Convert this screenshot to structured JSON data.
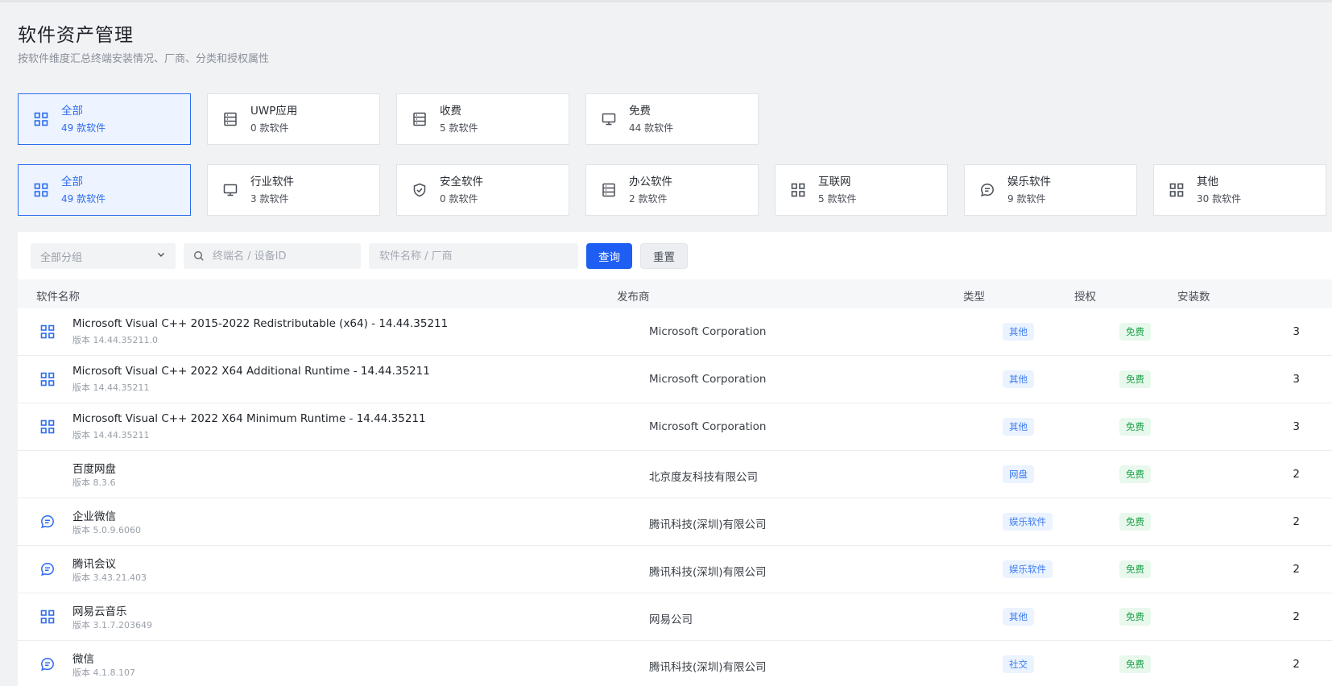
{
  "page": {
    "title": "软件资产管理",
    "subtitle": "按软件维度汇总终端安装情况、厂商、分类和授权属性"
  },
  "license_cards": [
    {
      "label": "全部",
      "count": "49 款软件",
      "icon": "grid-icon",
      "active": true
    },
    {
      "label": "UWP应用",
      "count": "0 款软件",
      "icon": "list-icon",
      "active": false
    },
    {
      "label": "收费",
      "count": "5 款软件",
      "icon": "list-icon",
      "active": false
    },
    {
      "label": "免费",
      "count": "44 款软件",
      "icon": "monitor-icon",
      "active": false
    }
  ],
  "category_cards": [
    {
      "label": "全部",
      "count": "49 款软件",
      "icon": "grid-icon",
      "active": true
    },
    {
      "label": "行业软件",
      "count": "3 款软件",
      "icon": "monitor-icon",
      "active": false
    },
    {
      "label": "安全软件",
      "count": "0 款软件",
      "icon": "shield-icon",
      "active": false
    },
    {
      "label": "办公软件",
      "count": "2 款软件",
      "icon": "list-icon",
      "active": false
    },
    {
      "label": "互联网",
      "count": "5 款软件",
      "icon": "grid-icon",
      "active": false
    },
    {
      "label": "娱乐软件",
      "count": "9 款软件",
      "icon": "chat-icon",
      "active": false
    },
    {
      "label": "其他",
      "count": "30 款软件",
      "icon": "grid-icon",
      "active": false
    }
  ],
  "filters": {
    "group_select": "全部分组",
    "terminal_placeholder": "终端名 / 设备ID",
    "software_placeholder": "软件名称 / 厂商",
    "query_label": "查询",
    "reset_label": "重置"
  },
  "table": {
    "headers": {
      "name": "软件名称",
      "publisher": "发布商",
      "type": "类型",
      "license": "授权",
      "installs": "安装数"
    },
    "rows": [
      {
        "name": "Microsoft Visual C++ 2015-2022 Redistributable (x64) - 14.44.35211",
        "version": "版本 14.44.35211.0",
        "publisher": "Microsoft Corporation",
        "type": "其他",
        "license": "免费",
        "installs": "3",
        "icon": "grid-icon"
      },
      {
        "name": "Microsoft Visual C++ 2022 X64 Additional Runtime - 14.44.35211",
        "version": "版本 14.44.35211",
        "publisher": "Microsoft Corporation",
        "type": "其他",
        "license": "免费",
        "installs": "3",
        "icon": "grid-icon"
      },
      {
        "name": "Microsoft Visual C++ 2022 X64 Minimum Runtime - 14.44.35211",
        "version": "版本 14.44.35211",
        "publisher": "Microsoft Corporation",
        "type": "其他",
        "license": "免费",
        "installs": "3",
        "icon": "grid-icon"
      },
      {
        "name": "百度网盘",
        "version": "版本 8.3.6",
        "publisher": "北京度友科技有限公司",
        "type": "网盘",
        "license": "免费",
        "installs": "2",
        "icon": ""
      },
      {
        "name": "企业微信",
        "version": "版本 5.0.9.6060",
        "publisher": "腾讯科技(深圳)有限公司",
        "type": "娱乐软件",
        "license": "免费",
        "installs": "2",
        "icon": "chat-icon"
      },
      {
        "name": "腾讯会议",
        "version": "版本 3.43.21.403",
        "publisher": "腾讯科技(深圳)有限公司",
        "type": "娱乐软件",
        "license": "免费",
        "installs": "2",
        "icon": "chat-icon"
      },
      {
        "name": "网易云音乐",
        "version": "版本 3.1.7.203649",
        "publisher": "网易公司",
        "type": "其他",
        "license": "免费",
        "installs": "2",
        "icon": "grid-icon"
      },
      {
        "name": "微信",
        "version": "版本 4.1.8.107",
        "publisher": "腾讯科技(深圳)有限公司",
        "type": "社交",
        "license": "免费",
        "installs": "2",
        "icon": "chat-icon"
      }
    ]
  }
}
